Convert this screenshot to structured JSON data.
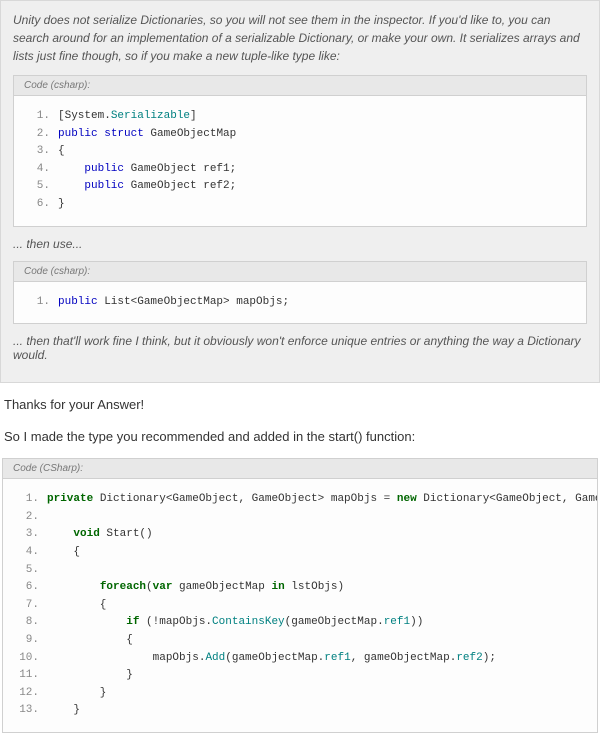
{
  "quote": {
    "intro": "Unity does not serialize Dictionaries, so you will not see them in the inspector. If you'd like to, you can search around for an implementation of a serializable Dictionary, or make your own. It serializes arrays and lists just fine though, so if you make a new tuple-like type like:",
    "code1_label": "Code (csharp):",
    "code1_lines": [
      {
        "n": "1.",
        "tokens": [
          {
            "t": "[System."
          },
          {
            "t": "Serializable",
            "c": "kw-teal"
          },
          {
            "t": "]"
          }
        ]
      },
      {
        "n": "2.",
        "tokens": [
          {
            "t": "public",
            "c": "kw-blue"
          },
          {
            "t": " "
          },
          {
            "t": "struct",
            "c": "kw-blue"
          },
          {
            "t": " GameObjectMap"
          }
        ]
      },
      {
        "n": "3.",
        "tokens": [
          {
            "t": "{"
          }
        ]
      },
      {
        "n": "4.",
        "tokens": [
          {
            "t": "    "
          },
          {
            "t": "public",
            "c": "kw-blue"
          },
          {
            "t": " GameObject ref1;"
          }
        ]
      },
      {
        "n": "5.",
        "tokens": [
          {
            "t": "    "
          },
          {
            "t": "public",
            "c": "kw-blue"
          },
          {
            "t": " GameObject ref2;"
          }
        ]
      },
      {
        "n": "6.",
        "tokens": [
          {
            "t": "}"
          }
        ]
      }
    ],
    "then_use": "... then use...",
    "code2_label": "Code (csharp):",
    "code2_lines": [
      {
        "n": "1.",
        "tokens": [
          {
            "t": "public",
            "c": "kw-blue"
          },
          {
            "t": " List<GameObjectMap> mapObjs;"
          }
        ]
      }
    ],
    "outro": "... then that'll work fine I think, but it obviously won't enforce unique entries or anything the way a Dictionary would."
  },
  "reply1": "Thanks for your Answer!",
  "reply2": "So I made the type you recommended and added in the start() function:",
  "code3_label": "Code (CSharp):",
  "code3_lines": [
    {
      "n": "1.",
      "tokens": [
        {
          "t": "private",
          "c": "kw-green"
        },
        {
          "t": " Dictionary<GameObject, GameObject> mapObjs = "
        },
        {
          "t": "new",
          "c": "kw-green"
        },
        {
          "t": " Dictionary<GameObject, GameObject>();"
        }
      ]
    },
    {
      "n": "2.",
      "tokens": []
    },
    {
      "n": "3.",
      "tokens": [
        {
          "t": "    "
        },
        {
          "t": "void",
          "c": "kw-green"
        },
        {
          "t": " Start()"
        }
      ]
    },
    {
      "n": "4.",
      "tokens": [
        {
          "t": "    {"
        }
      ]
    },
    {
      "n": "5.",
      "tokens": []
    },
    {
      "n": "6.",
      "tokens": [
        {
          "t": "        "
        },
        {
          "t": "foreach",
          "c": "kw-green"
        },
        {
          "t": "("
        },
        {
          "t": "var",
          "c": "kw-green"
        },
        {
          "t": " gameObjectMap "
        },
        {
          "t": "in",
          "c": "kw-green"
        },
        {
          "t": " lstObjs)"
        }
      ]
    },
    {
      "n": "7.",
      "tokens": [
        {
          "t": "        {"
        }
      ]
    },
    {
      "n": "8.",
      "tokens": [
        {
          "t": "            "
        },
        {
          "t": "if",
          "c": "kw-green"
        },
        {
          "t": " (!mapObjs."
        },
        {
          "t": "ContainsKey",
          "c": "kw-teal"
        },
        {
          "t": "(gameObjectMap."
        },
        {
          "t": "ref1",
          "c": "kw-teal"
        },
        {
          "t": "))"
        }
      ]
    },
    {
      "n": "9.",
      "tokens": [
        {
          "t": "            {"
        }
      ]
    },
    {
      "n": "10.",
      "tokens": [
        {
          "t": "                mapObjs."
        },
        {
          "t": "Add",
          "c": "kw-teal"
        },
        {
          "t": "(gameObjectMap."
        },
        {
          "t": "ref1",
          "c": "kw-teal"
        },
        {
          "t": ", gameObjectMap."
        },
        {
          "t": "ref2",
          "c": "kw-teal"
        },
        {
          "t": ");"
        }
      ]
    },
    {
      "n": "11.",
      "tokens": [
        {
          "t": "            }"
        }
      ]
    },
    {
      "n": "12.",
      "tokens": [
        {
          "t": "        }"
        }
      ]
    },
    {
      "n": "13.",
      "tokens": [
        {
          "t": "    }"
        }
      ]
    }
  ]
}
